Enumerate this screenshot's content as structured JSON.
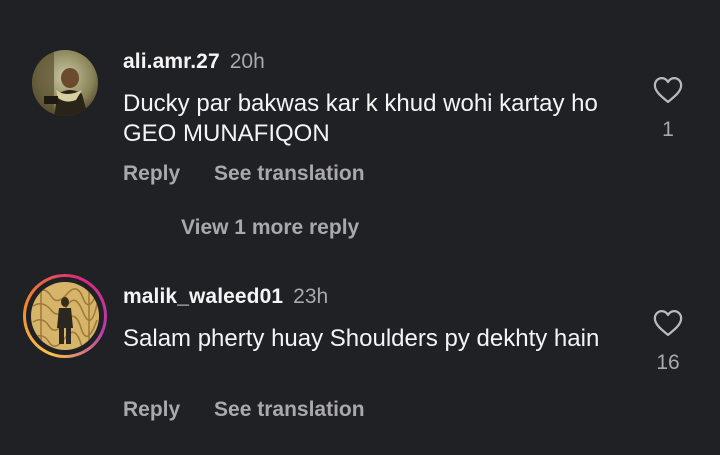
{
  "comments": [
    {
      "username": "ali.amr.27",
      "time": "20h",
      "text": "Ducky par bakwas kar k khud wohi kartay ho GEO MUNAFIQON",
      "likes": "1",
      "reply_label": "Reply",
      "translate_label": "See translation",
      "avatar_icon": "user-photo-avatar",
      "has_story_ring": false
    },
    {
      "username": "malik_waleed01",
      "time": "23h",
      "text": "Salam pherty huay Shoulders py dekhty hain",
      "likes": "16",
      "reply_label": "Reply",
      "translate_label": "See translation",
      "avatar_icon": "user-photo-avatar",
      "has_story_ring": true
    }
  ],
  "view_more_replies": "View 1 more reply",
  "colors": {
    "background": "#202125",
    "text": "#f4f4f5",
    "muted": "#a8a8ad",
    "story_ring": [
      "#f9c44b",
      "#f58529",
      "#dd2a7b",
      "#b53baa"
    ]
  },
  "icons": {
    "like": "heart-outline-icon"
  }
}
